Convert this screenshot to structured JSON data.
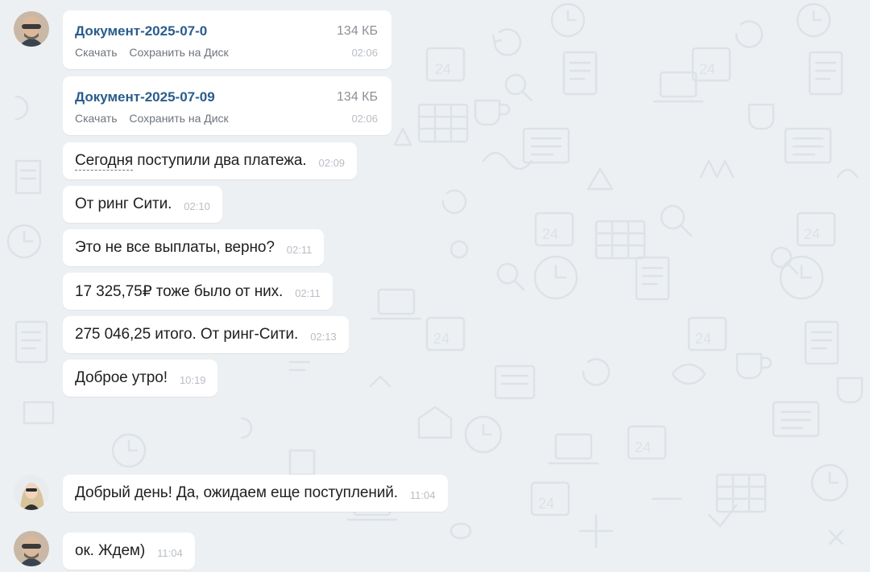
{
  "files": [
    {
      "name": "Документ-2025-07-0",
      "size": "134 КБ",
      "download": "Скачать",
      "save": "Сохранить на Диск",
      "time": "02:06"
    },
    {
      "name": "Документ-2025-07-09",
      "size": "134 КБ",
      "download": "Скачать",
      "save": "Сохранить на Диск",
      "time": "02:06"
    }
  ],
  "messages": [
    {
      "text_underlined": "Сегодня",
      "text": " поступили два платежа.",
      "time": "02:09"
    },
    {
      "text": "От ринг Сити.",
      "time": "02:10"
    },
    {
      "text": "Это не все выплаты, верно?",
      "time": "02:11"
    },
    {
      "text": "17 325,75₽ тоже было от них.",
      "time": "02:11"
    },
    {
      "text": "275 046,25 итого. От ринг-Сити.",
      "time": "02:13"
    },
    {
      "text": "Доброе утро!",
      "time": "10:19"
    },
    {
      "text": "Добрый день! Да, ожидаем еще поступлений.",
      "time": "11:04"
    },
    {
      "text": "ок. Ждем)",
      "time": "11:04"
    }
  ],
  "colors": {
    "background": "#edf0f3",
    "bubble": "#ffffff",
    "file_link": "#2a5c8c",
    "timestamp": "#b9bec4"
  }
}
